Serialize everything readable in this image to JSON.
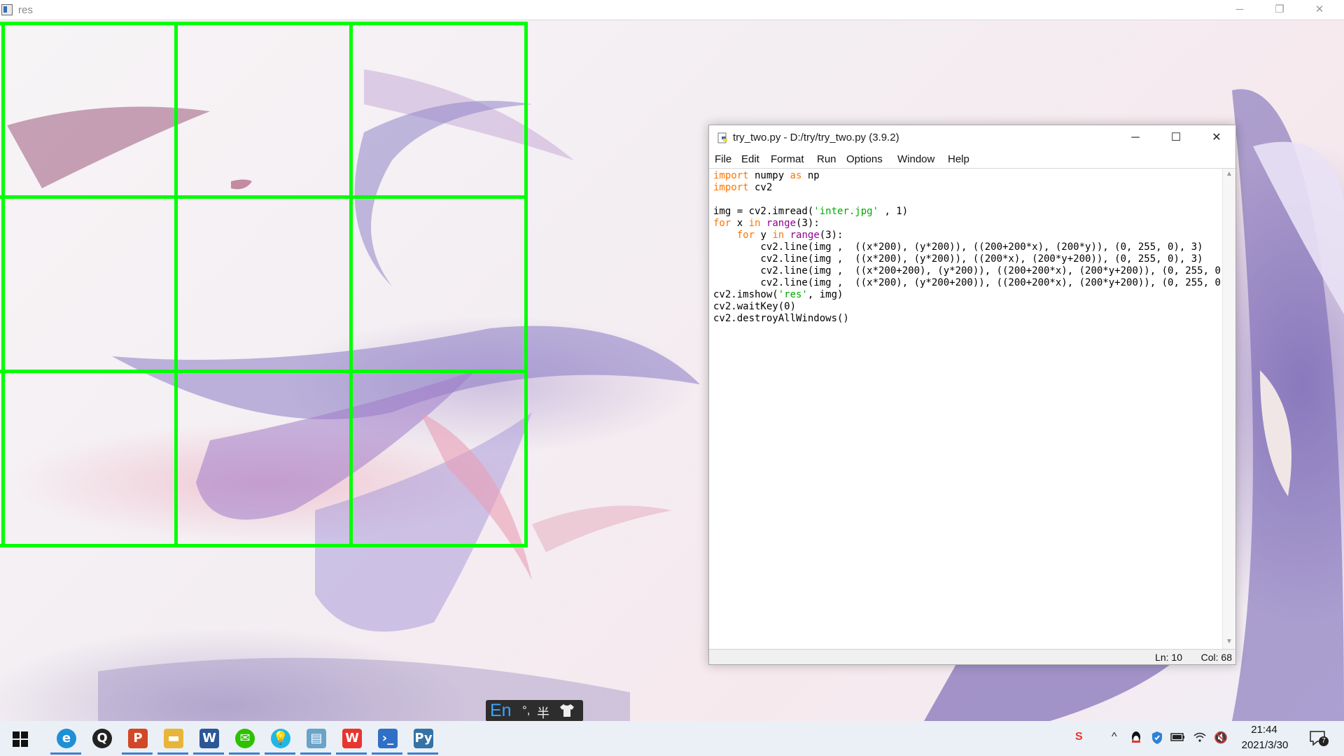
{
  "res_window": {
    "title": "res",
    "controls": {
      "minimize": "─",
      "restore": "❐",
      "close": "✕"
    },
    "grid_color": "#00ff00"
  },
  "idle_window": {
    "title": "try_two.py - D:/try/try_two.py (3.9.2)",
    "controls": {
      "minimize": "─",
      "maximize": "☐",
      "close": "✕"
    },
    "menu": [
      "File",
      "Edit",
      "Format",
      "Run",
      "Options",
      "Window",
      "Help"
    ],
    "status": {
      "line": "Ln: 10",
      "col": "Col: 68"
    }
  },
  "code": [
    [
      {
        "t": "import",
        "c": "kw"
      },
      {
        "t": " numpy "
      },
      {
        "t": "as",
        "c": "kw"
      },
      {
        "t": " np"
      }
    ],
    [
      {
        "t": "import",
        "c": "kw"
      },
      {
        "t": " cv2"
      }
    ],
    [],
    [
      {
        "t": "img = cv2.imread("
      },
      {
        "t": "'inter.jpg'",
        "c": "st"
      },
      {
        "t": " , 1)"
      }
    ],
    [
      {
        "t": "for",
        "c": "kw"
      },
      {
        "t": " x "
      },
      {
        "t": "in",
        "c": "kw"
      },
      {
        "t": " "
      },
      {
        "t": "range",
        "c": "bi"
      },
      {
        "t": "(3):"
      }
    ],
    [
      {
        "t": "    "
      },
      {
        "t": "for",
        "c": "kw"
      },
      {
        "t": " y "
      },
      {
        "t": "in",
        "c": "kw"
      },
      {
        "t": " "
      },
      {
        "t": "range",
        "c": "bi"
      },
      {
        "t": "(3):"
      }
    ],
    [
      {
        "t": "        cv2.line(img ,  ((x*200), (y*200)), ((200+200*x), (200*y)), (0, 255, 0), 3)"
      }
    ],
    [
      {
        "t": "        cv2.line(img ,  ((x*200), (y*200)), ((200*x), (200*y+200)), (0, 255, 0), 3)"
      }
    ],
    [
      {
        "t": "        cv2.line(img ,  ((x*200+200), (y*200)), ((200+200*x), (200*y+200)), (0, 255, 0)"
      }
    ],
    [
      {
        "t": "        cv2.line(img ,  ((x*200), (y*200+200)), ((200+200*x), (200*y+200)), (0, 255, 0)"
      }
    ],
    [
      {
        "t": "cv2.imshow("
      },
      {
        "t": "'res'",
        "c": "st"
      },
      {
        "t": ", img)"
      }
    ],
    [
      {
        "t": "cv2.waitKey(0)"
      }
    ],
    [
      {
        "t": "cv2.destroyAllWindows()"
      }
    ]
  ],
  "ime": {
    "mode": "En",
    "punct": "°,",
    "width": "半",
    "skin": "shirt-icon"
  },
  "taskbar": {
    "apps": [
      {
        "name": "edge-icon",
        "color": "#1f8fd6",
        "glyph": "e"
      },
      {
        "name": "qq-icon",
        "color": "#222222",
        "glyph": "Q"
      },
      {
        "name": "powerpoint-icon",
        "color": "#d24726",
        "glyph": "P"
      },
      {
        "name": "file-explorer-icon",
        "color": "#e8b53a",
        "glyph": "▬"
      },
      {
        "name": "word-icon",
        "color": "#2b5797",
        "glyph": "W"
      },
      {
        "name": "wechat-icon",
        "color": "#2dc100",
        "glyph": "✉"
      },
      {
        "name": "bulb-icon",
        "color": "#1fb8e6",
        "glyph": "💡"
      },
      {
        "name": "notebook-icon",
        "color": "#6aa3c8",
        "glyph": "▤"
      },
      {
        "name": "wps-icon",
        "color": "#e8352e",
        "glyph": "W"
      },
      {
        "name": "powershell-icon",
        "color": "#2f6fc6",
        "glyph": "›_"
      },
      {
        "name": "python-idle-icon",
        "color": "#3572a5",
        "glyph": "Py"
      }
    ],
    "tray": {
      "sogou": "S",
      "chevron": "^",
      "volume": "🔇"
    },
    "clock": {
      "time": "21:44",
      "date": "2021/3/30"
    },
    "notifications": "7"
  }
}
